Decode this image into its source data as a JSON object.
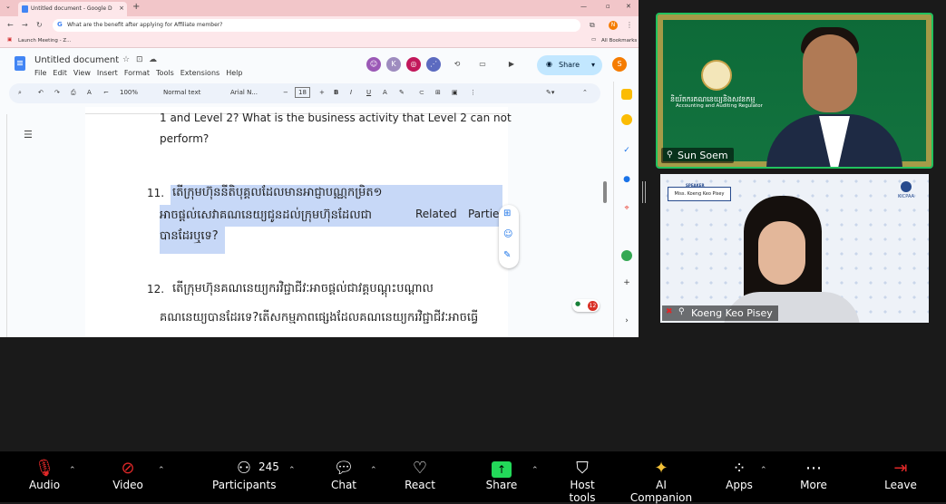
{
  "browser": {
    "tab_title": "Untitled document - Google D",
    "address": "What are the benefit after applying for Affiliate member?",
    "bookmark_item": "Launch Meeting - Z...",
    "all_bookmarks": "All Bookmarks",
    "profile_letter": "N"
  },
  "docs": {
    "title": "Untitled document",
    "menu": [
      "File",
      "Edit",
      "View",
      "Insert",
      "Format",
      "Tools",
      "Extensions",
      "Help"
    ],
    "share_label": "Share",
    "user_initial": "S",
    "avatar_k": "K",
    "zoom": "100%",
    "style": "Normal text",
    "font": "Arial N...",
    "font_size": "18",
    "comment_badge": "12",
    "body": {
      "line_a": "1 and Level 2? What is the business activity that Level 2 can not",
      "line_b": "perform?",
      "q11_num": "11.",
      "q11_l1": "តើក្រុមហ៊ុននីតិបុគ្គលដែលមានអាជ្ញាបណ្ណកម្រិត១",
      "q11_l2": "អាចផ្តល់សេវាគណនេយ្យជូនដល់ក្រុមហ៊ុនដែលជា",
      "q11_l2_en": "Related",
      "q11_l2_en2": "Parties",
      "q11_l3": "បានដែរឬទេ?",
      "q12_num": "12.",
      "q12_l1": "តើក្រុមហ៊ុនគណនេយ្យករវិជ្ជាជីវៈអាចផ្តល់ជាវគ្គបណ្តុះបណ្តាល",
      "q12_l2": "គណនេយ្យបានដែរទេ?តើសកម្មភាពផ្សេងដែលគណនេយ្យករវិជ្ជាជីវៈអាចធ្វើ"
    }
  },
  "video": {
    "p1_name": "Sun Soem",
    "p1_org_kh": "និយ័តករគណនេយ្យនិងសវនកម្ម",
    "p1_org_en": "Accounting and Auditing Regulator",
    "p2_name": "Koeng Keo Pisey",
    "p2_speaker_label": "SPEAKER",
    "p2_speaker_name": "Miss. Koeng Keo Pisey",
    "p2_logo": "KICPAA"
  },
  "zoom_bar": {
    "audio": "Audio",
    "video": "Video",
    "participants": "Participants",
    "participant_count": "245",
    "chat": "Chat",
    "react": "React",
    "share": "Share",
    "host_tools": "Host tools",
    "ai_companion": "AI Companion",
    "apps": "Apps",
    "more": "More",
    "leave": "Leave"
  }
}
